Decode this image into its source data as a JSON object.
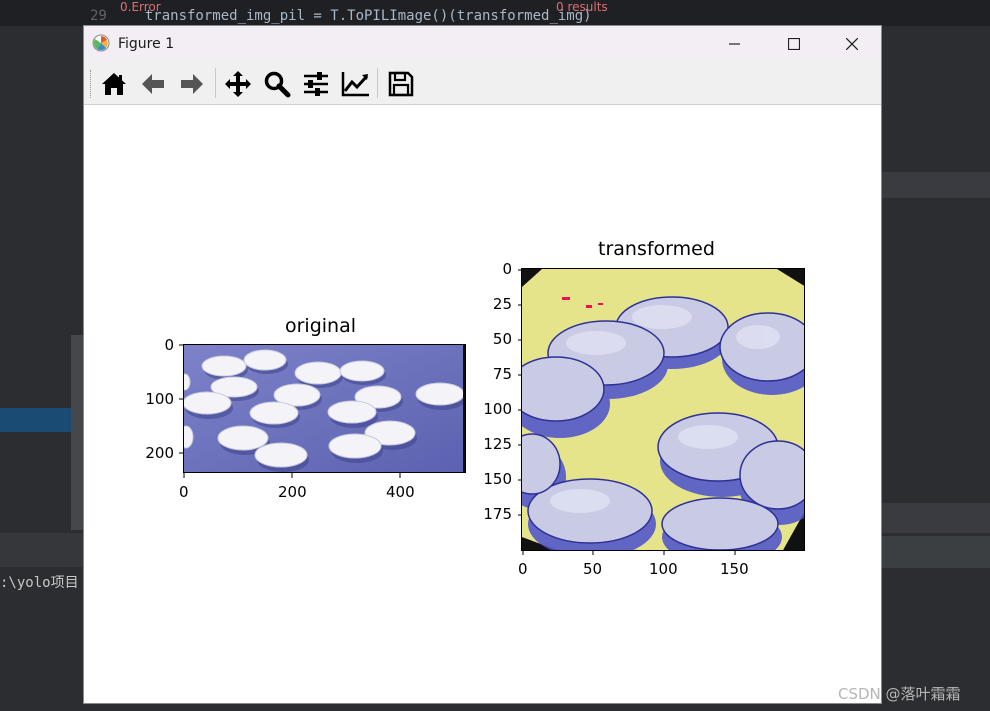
{
  "ide": {
    "line_no": "29",
    "code_line": "transformed_img_pil = T.ToPILImage()(transformed_img)",
    "error_label": "0.Error",
    "results_label": "0 results",
    "path_fragment": ":\\yolo项目",
    "watermark": "CSDN @落叶霜霜"
  },
  "window": {
    "title": "Figure 1"
  },
  "toolbar": {
    "buttons": [
      "home-icon",
      "back-arrow-icon",
      "forward-arrow-icon",
      "pan-icon",
      "zoom-icon",
      "configure-subplots-icon",
      "edit-axes-icon",
      "save-icon"
    ]
  },
  "subplots": [
    {
      "title": "original",
      "x_ticks": [
        "0",
        "200",
        "400"
      ],
      "y_ticks": [
        "0",
        "100",
        "200"
      ],
      "xlim": [
        0,
        525
      ],
      "ylim": [
        0,
        240
      ]
    },
    {
      "title": "transformed",
      "x_ticks": [
        "0",
        "50",
        "100",
        "150"
      ],
      "y_ticks": [
        "0",
        "25",
        "50",
        "75",
        "100",
        "125",
        "150",
        "175"
      ],
      "xlim": [
        0,
        200
      ],
      "ylim": [
        0,
        200
      ]
    }
  ],
  "colors": {
    "background_blue": "#6f74c0",
    "pill_white": "#f4f4f8",
    "transformed_yellow": "#e5e48a",
    "transformed_pill": "#c9cbe4"
  }
}
